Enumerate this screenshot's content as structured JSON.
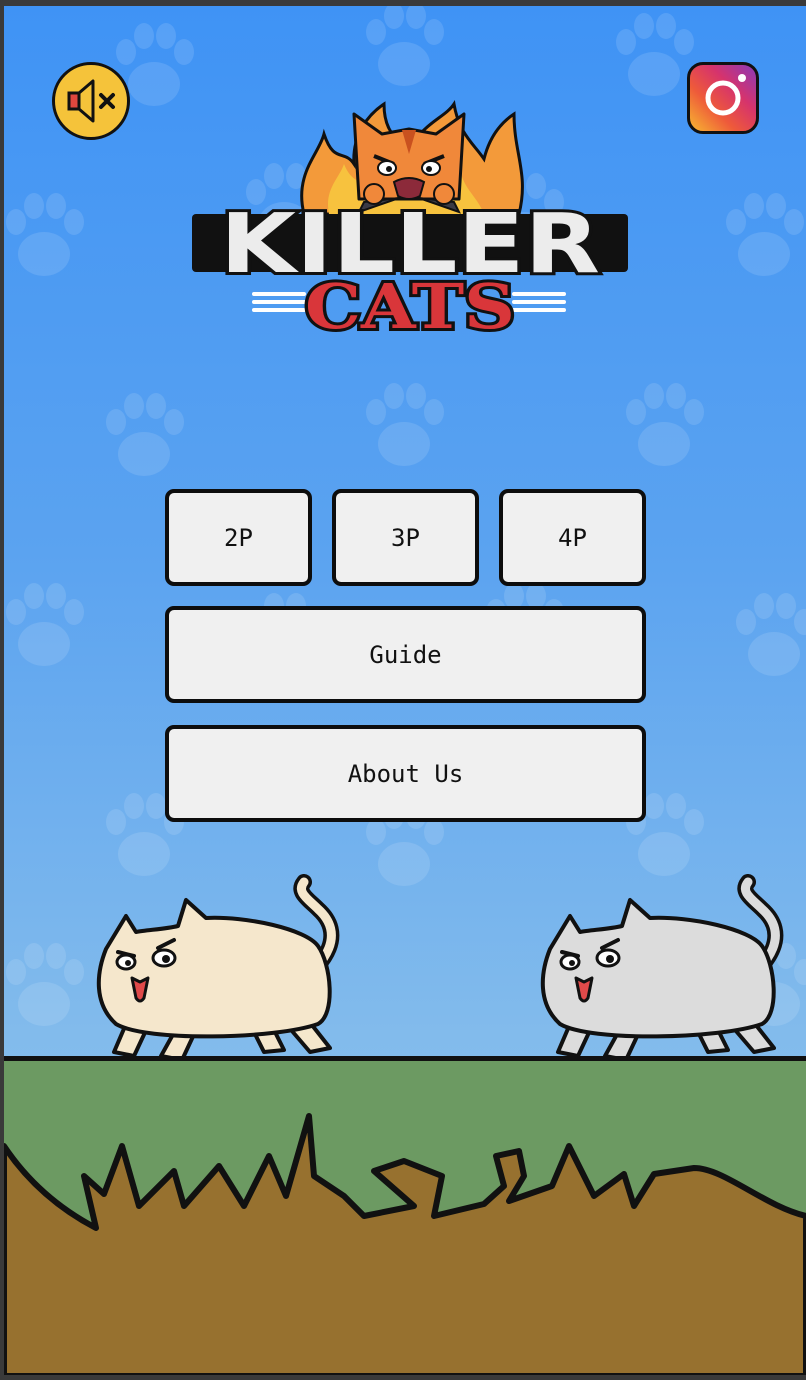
{
  "game": {
    "title": "KILLER",
    "subtitle": "CATS"
  },
  "top_bar": {
    "sound_icon": "speaker-muted-icon",
    "social_icon": "instagram-icon"
  },
  "menu": {
    "player_buttons": [
      "2P",
      "3P",
      "4P"
    ],
    "guide_label": "Guide",
    "about_label": "About Us"
  },
  "scene": {
    "cats": [
      {
        "color": "#f5e7cc"
      },
      {
        "color": "#dcdcdc"
      }
    ],
    "grass_color": "#6c9a62",
    "dirt_color": "#97712f",
    "sky_color": "#4a97f2"
  }
}
